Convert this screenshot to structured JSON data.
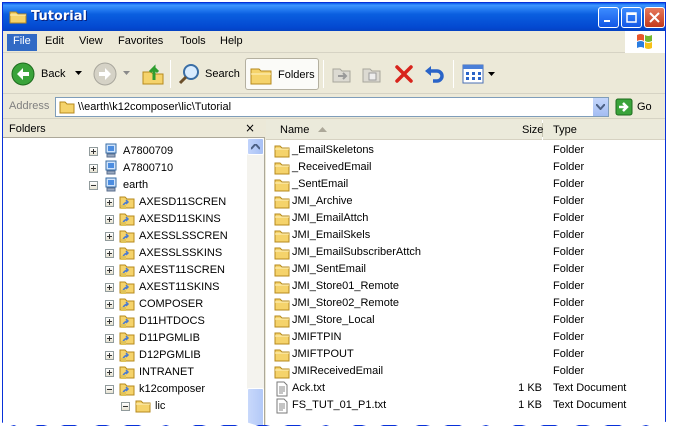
{
  "window": {
    "title": "Tutorial"
  },
  "menu": [
    "File",
    "Edit",
    "View",
    "Favorites",
    "Tools",
    "Help"
  ],
  "toolbar": {
    "back_label": "Back",
    "search_label": "Search",
    "folders_label": "Folders"
  },
  "address": {
    "label": "Address",
    "value": "\\\\earth\\k12composer\\lic\\Tutorial",
    "go_label": "Go"
  },
  "folders_pane": {
    "title": "Folders",
    "close_glyph": "×",
    "tree": [
      {
        "label": "A7800709",
        "icon": "computer-icon",
        "expander": "+"
      },
      {
        "label": "A7800710",
        "icon": "computer-icon",
        "expander": "+"
      },
      {
        "label": "earth",
        "icon": "computer-icon",
        "expander": "-"
      },
      {
        "label": "AXESD11SCREN",
        "icon": "shared-folder-icon",
        "expander": "+"
      },
      {
        "label": "AXESD11SKINS",
        "icon": "shared-folder-icon",
        "expander": "+"
      },
      {
        "label": "AXESSLSSCREN",
        "icon": "shared-folder-icon",
        "expander": "+"
      },
      {
        "label": "AXESSLSSKINS",
        "icon": "shared-folder-icon",
        "expander": "+"
      },
      {
        "label": "AXEST11SCREN",
        "icon": "shared-folder-icon",
        "expander": "+"
      },
      {
        "label": "AXEST11SKINS",
        "icon": "shared-folder-icon",
        "expander": "+"
      },
      {
        "label": "COMPOSER",
        "icon": "shared-folder-icon",
        "expander": "+"
      },
      {
        "label": "D11HTDOCS",
        "icon": "shared-folder-icon",
        "expander": "+"
      },
      {
        "label": "D11PGMLIB",
        "icon": "shared-folder-icon",
        "expander": "+"
      },
      {
        "label": "D12PGMLIB",
        "icon": "shared-folder-icon",
        "expander": "+"
      },
      {
        "label": "INTRANET",
        "icon": "shared-folder-icon",
        "expander": "+"
      },
      {
        "label": "k12composer",
        "icon": "shared-folder-icon",
        "expander": "-"
      },
      {
        "label": "lic",
        "icon": "folder-icon",
        "expander": "-"
      }
    ]
  },
  "file_list": {
    "columns": {
      "name": "Name",
      "size": "Size",
      "type": "Type"
    },
    "rows": [
      {
        "name": "_EmailSkeletons",
        "size": "",
        "type": "Folder",
        "icon": "folder-icon"
      },
      {
        "name": "_ReceivedEmail",
        "size": "",
        "type": "Folder",
        "icon": "folder-icon"
      },
      {
        "name": "_SentEmail",
        "size": "",
        "type": "Folder",
        "icon": "folder-icon"
      },
      {
        "name": "JMI_Archive",
        "size": "",
        "type": "Folder",
        "icon": "folder-icon"
      },
      {
        "name": "JMI_EmailAttch",
        "size": "",
        "type": "Folder",
        "icon": "folder-icon"
      },
      {
        "name": "JMI_EmailSkels",
        "size": "",
        "type": "Folder",
        "icon": "folder-icon"
      },
      {
        "name": "JMI_EmailSubscriberAttch",
        "size": "",
        "type": "Folder",
        "icon": "folder-icon"
      },
      {
        "name": "JMI_SentEmail",
        "size": "",
        "type": "Folder",
        "icon": "folder-icon"
      },
      {
        "name": "JMI_Store01_Remote",
        "size": "",
        "type": "Folder",
        "icon": "folder-icon"
      },
      {
        "name": "JMI_Store02_Remote",
        "size": "",
        "type": "Folder",
        "icon": "folder-icon"
      },
      {
        "name": "JMI_Store_Local",
        "size": "",
        "type": "Folder",
        "icon": "folder-icon"
      },
      {
        "name": "JMIFTPIN",
        "size": "",
        "type": "Folder",
        "icon": "folder-icon"
      },
      {
        "name": "JMIFTPOUT",
        "size": "",
        "type": "Folder",
        "icon": "folder-icon"
      },
      {
        "name": "JMIReceivedEmail",
        "size": "",
        "type": "Folder",
        "icon": "folder-icon"
      },
      {
        "name": "Ack.txt",
        "size": "1 KB",
        "type": "Text Document",
        "icon": "text-file-icon"
      },
      {
        "name": "FS_TUT_01_P1.txt",
        "size": "1 KB",
        "type": "Text Document",
        "icon": "text-file-icon"
      }
    ]
  },
  "colors": {
    "titlebar": "#0a5fe0",
    "menu_highlight": "#316ac5",
    "folder": "#f5d36b"
  }
}
